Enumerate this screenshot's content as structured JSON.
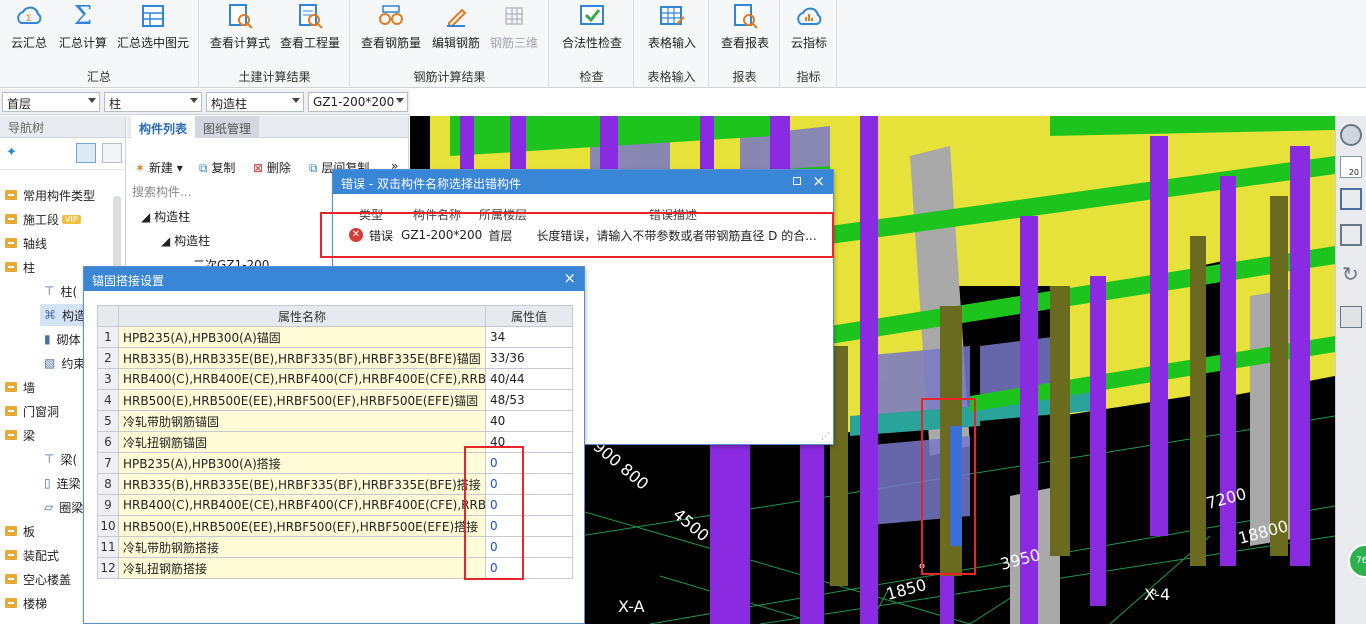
{
  "ribbon": {
    "groups": [
      {
        "title": "汇总",
        "buttons": [
          "云汇总",
          "汇总计算",
          "汇总选中图元"
        ]
      },
      {
        "title": "土建计算结果",
        "buttons": [
          "查看计算式",
          "查看工程量"
        ]
      },
      {
        "title": "钢筋计算结果",
        "buttons": [
          "查看钢筋量",
          "编辑钢筋",
          "钢筋三维"
        ]
      },
      {
        "title": "检查",
        "buttons": [
          "合法性检查"
        ]
      },
      {
        "title": "表格输入",
        "buttons": [
          "表格输入"
        ]
      },
      {
        "title": "报表",
        "buttons": [
          "查看报表"
        ]
      },
      {
        "title": "指标",
        "buttons": [
          "云指标"
        ]
      }
    ]
  },
  "selectors": {
    "floor": "首层",
    "category": "柱",
    "type": "构造柱",
    "component": "GZ1-200*200"
  },
  "nav": {
    "title": "导航树",
    "items": [
      "常用构件类型",
      "施工段",
      "轴线",
      "柱",
      "柱(",
      "构造",
      "砌体",
      "约束",
      "墙",
      "门窗洞",
      "梁",
      "梁(",
      "连梁",
      "圈梁",
      "板",
      "装配式",
      "空心楼盖",
      "楼梯"
    ],
    "vip": "VIP"
  },
  "comp": {
    "tabs": [
      "构件列表",
      "图纸管理"
    ],
    "new": "新建",
    "copy": "复制",
    "delete": "删除",
    "floorcopy": "层间复制",
    "search_placeholder": "搜索构件...",
    "tree": [
      "构造柱",
      "构造柱",
      "二次GZ1-200"
    ]
  },
  "error_dialog": {
    "title": "错误 - 双击构件名称选择出错构件",
    "headers": [
      "类型",
      "构件名称",
      "所属楼层",
      "错误描述"
    ],
    "row": {
      "type": "错误",
      "name": "GZ1-200*200",
      "floor": "首层",
      "desc": "长度错误，请输入不带参数或者带钢筋直径 D 的合..."
    }
  },
  "anchor_dialog": {
    "title": "锚固搭接设置",
    "headers": [
      "属性名称",
      "属性值"
    ],
    "rows": [
      {
        "n": "1",
        "name": "HPB235(A),HPB300(A)锚固",
        "val": "34"
      },
      {
        "n": "2",
        "name": "HRB335(B),HRB335E(BE),HRBF335(BF),HRBF335E(BFE)锚固",
        "val": "33/36"
      },
      {
        "n": "3",
        "name": "HRB400(C),HRB400E(CE),HRBF400(CF),HRBF400E(CFE),RRB40...",
        "val": "40/44"
      },
      {
        "n": "4",
        "name": "HRB500(E),HRB500E(EE),HRBF500(EF),HRBF500E(EFE)锚固",
        "val": "48/53"
      },
      {
        "n": "5",
        "name": "冷轧带肋钢筋锚固",
        "val": "40"
      },
      {
        "n": "6",
        "name": "冷轧扭钢筋锚固",
        "val": "40"
      },
      {
        "n": "7",
        "name": "HPB235(A),HPB300(A)搭接",
        "val": "0"
      },
      {
        "n": "8",
        "name": "HRB335(B),HRB335E(BE),HRBF335(BF),HRBF335E(BFE)搭接",
        "val": "0"
      },
      {
        "n": "9",
        "name": "HRB400(C),HRB400E(CE),HRBF400(CF),HRBF400E(CFE),RRB40...",
        "val": "0"
      },
      {
        "n": "10",
        "name": "HRB500(E),HRB500E(EE),HRBF500(EF),HRBF500E(EFE)搭接",
        "val": "0"
      },
      {
        "n": "11",
        "name": "冷轧带肋钢筋搭接",
        "val": "0"
      },
      {
        "n": "12",
        "name": "冷轧扭钢筋搭接",
        "val": "0"
      }
    ]
  },
  "viewport": {
    "dims": [
      "900 800",
      "4500",
      "1850",
      "3950",
      "7200",
      "18800"
    ],
    "axes": [
      "X-A",
      "X-4",
      "X"
    ],
    "badge": "76",
    "zoom": "20"
  }
}
